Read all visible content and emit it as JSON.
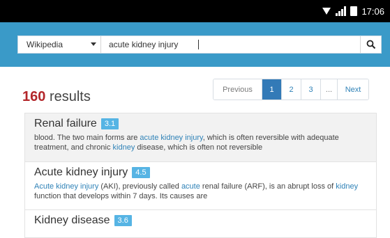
{
  "status_bar": {
    "time": "17:06"
  },
  "search": {
    "source": "Wikipedia",
    "query": "acute kidney injury"
  },
  "results_header": {
    "count": "160",
    "label": "results"
  },
  "pagination": {
    "previous": "Previous",
    "pages": [
      "1",
      "2",
      "3"
    ],
    "active": "1",
    "ellipsis": "...",
    "next": "Next"
  },
  "results": [
    {
      "title": "Renal failure",
      "score": "3.1",
      "snippet": [
        {
          "t": "blood. The two main forms are ",
          "hl": false
        },
        {
          "t": "acute kidney injury",
          "hl": true
        },
        {
          "t": ", which is often reversible with adequate treatment, and chronic ",
          "hl": false
        },
        {
          "t": "kidney",
          "hl": true
        },
        {
          "t": " disease, which is often not reversible",
          "hl": false
        }
      ]
    },
    {
      "title": "Acute kidney injury",
      "score": "4.5",
      "snippet": [
        {
          "t": "Acute kidney injury",
          "hl": true
        },
        {
          "t": " (AKI), previously called ",
          "hl": false
        },
        {
          "t": "acute",
          "hl": true
        },
        {
          "t": " renal failure (ARF), is an abrupt loss of ",
          "hl": false
        },
        {
          "t": "kidney",
          "hl": true
        },
        {
          "t": " function that develops within 7 days. Its causes are",
          "hl": false
        }
      ]
    },
    {
      "title": "Kidney disease",
      "score": "3.6",
      "snippet": []
    }
  ],
  "colors": {
    "toolbar": "#3a9ac8",
    "count": "#b3262a",
    "badge": "#56b4e4",
    "active_page": "#337ab7",
    "link": "#2f82b7"
  },
  "icons": {
    "search": "search-icon",
    "wifi": "wifi-icon",
    "signal": "signal-icon",
    "battery": "battery-icon"
  }
}
